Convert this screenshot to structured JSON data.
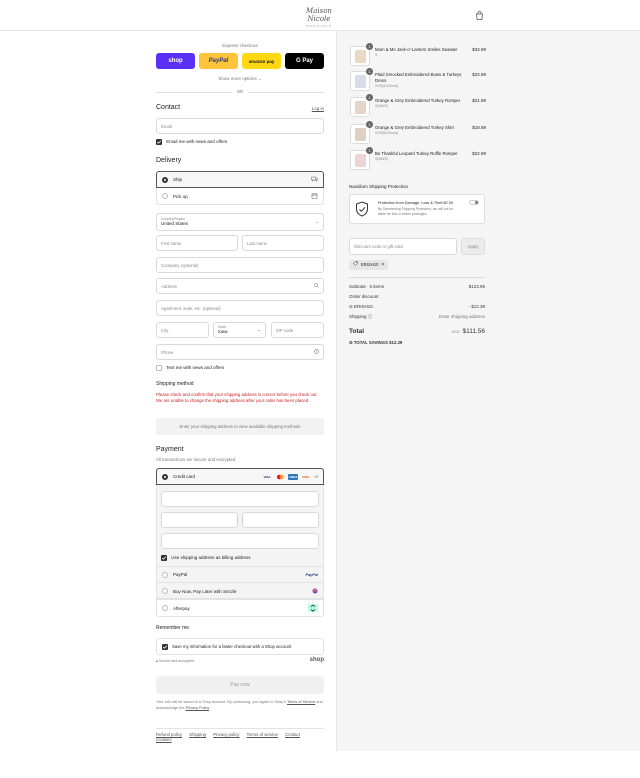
{
  "brand": {
    "logo_text": "Maison Nicole",
    "logo_sub": "BOUTIQUE"
  },
  "express": {
    "title": "Express checkout",
    "buttons": [
      "shop",
      "PayPal",
      "amazon pay",
      "G Pay"
    ],
    "show_more": "Show more options",
    "or": "OR"
  },
  "contact": {
    "heading": "Contact",
    "login": "Log in",
    "email_placeholder": "Email",
    "news_label": "Email me with news and offers"
  },
  "delivery": {
    "heading": "Delivery",
    "options": [
      "Ship",
      "Pick up"
    ],
    "country_label": "Country/Region",
    "country_value": "United States",
    "first_name": "First name",
    "last_name": "Last name",
    "company": "Company (optional)",
    "address": "Address",
    "apartment": "Apartment, suite, etc. (optional)",
    "city": "City",
    "state_label": "State",
    "state_value": "Iowa",
    "zip": "ZIP code",
    "phone": "Phone",
    "text_news": "Text me with news and offers"
  },
  "shipping_method": {
    "heading": "Shipping method",
    "warning": "Please check and confirm that your shipping address is correct before you check out. We are unable to change the shipping address after your order has been placed.",
    "placeholder": "Enter your shipping address to view available shipping methods"
  },
  "payment": {
    "heading": "Payment",
    "subtitle": "All transactions are secure and encrypted.",
    "credit_card": "Credit card",
    "card_brands": [
      "VISA",
      "MC",
      "AMEX",
      "DISC"
    ],
    "more_cards": "+5",
    "billing_same": "Use shipping address as billing address",
    "methods": [
      "PayPal",
      "Buy Now, Pay Later with Sezzle",
      "Afterpay"
    ],
    "paypal_logo": "PayPal"
  },
  "remember": {
    "heading": "Remember me",
    "label": "Save my information for a faster checkout with a Shop account",
    "secure": "Secure and encrypted",
    "shop_logo": "shop"
  },
  "pay_now": "Pay now",
  "terms": {
    "text": "Your info will be saved to a Shop account. By continuing, you agree to Shop's",
    "tos": "Terms of Service",
    "and": "and acknowledge the",
    "privacy": "Privacy Policy",
    "end": "."
  },
  "footer_links": [
    "Refund policy",
    "Shipping",
    "Privacy policy",
    "Terms of service",
    "Contact",
    "Cookies"
  ],
  "cart": {
    "items": [
      {
        "qty": "1",
        "name": "Mom & Me Jack-o'-Lantern Smiles Sweater",
        "variant": "S",
        "price": "$34.99",
        "color": "#e8d8c4"
      },
      {
        "qty": "1",
        "name": "Plaid Smocked Embroidered Bows & Turkeys Dress",
        "variant": "XXS(6/12mos)",
        "price": "$24.99",
        "color": "#d7dce9"
      },
      {
        "qty": "1",
        "name": "Orange & Grey Embroidered Turkey Romper",
        "variant": "S(4M/3)",
        "price": "$21.99",
        "color": "#e3d5c8"
      },
      {
        "qty": "1",
        "name": "Orange & Grey Embroidered Turkey Shirt",
        "variant": "XXS(6/12mos)",
        "price": "$18.99",
        "color": "#ded1c4"
      },
      {
        "qty": "1",
        "name": "Be Thankful Leopard Turkey Ruffle Romper",
        "variant": "S(6M/3)",
        "price": "$22.99",
        "color": "#efd4d4"
      }
    ]
  },
  "protection": {
    "heading": "Navidium Shipping Protection",
    "title": "Protection from Damage, Loss & Theft $2.00",
    "desc": "By Deselecting Shipping Protection, we will not be liable for lost or stolen packages."
  },
  "discount": {
    "placeholder": "Discount code or gift card",
    "apply": "Apply",
    "tag": "ERISH10"
  },
  "summary": {
    "subtotal_label": "Subtotal · 5 items",
    "subtotal": "$123.95",
    "order_discount": "Order discount",
    "code": "ERISH10",
    "discount_value": "- $12.39",
    "shipping_label": "Shipping",
    "shipping_value": "Enter shipping address",
    "total_label": "Total",
    "currency": "USD",
    "total": "$111.56",
    "savings_label": "TOTAL SAVINGS",
    "savings": "$12.39"
  }
}
